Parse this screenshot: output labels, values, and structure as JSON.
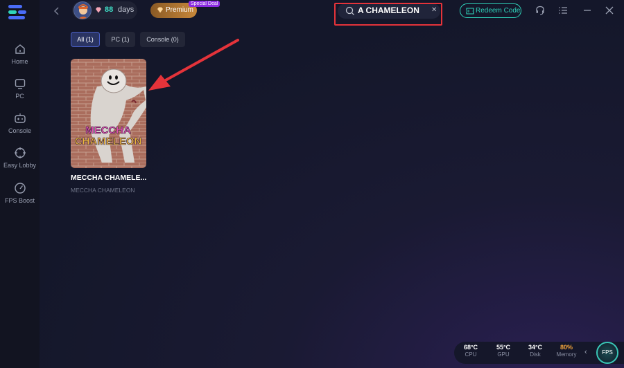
{
  "sidebar": {
    "items": [
      {
        "label": "Home",
        "icon": "home-icon"
      },
      {
        "label": "PC",
        "icon": "monitor-icon"
      },
      {
        "label": "Console",
        "icon": "gamepad-icon"
      },
      {
        "label": "Easy Lobby",
        "icon": "crosshair-icon"
      },
      {
        "label": "FPS Boost",
        "icon": "speedometer-icon"
      }
    ]
  },
  "header": {
    "days_value": "88",
    "days_unit": "days",
    "premium_label": "Premium",
    "special_deal": "Special Deal",
    "search_value": "A CHAMELEON",
    "redeem_label": "Redeem Code"
  },
  "tabs": [
    {
      "label": "All (1)",
      "active": true
    },
    {
      "label": "PC (1)",
      "active": false
    },
    {
      "label": "Console (0)",
      "active": false
    }
  ],
  "games": [
    {
      "title": "MECCHA CHAMELE...",
      "subtitle": "MECCHA CHAMELEON",
      "art_text_1": "MECCHA",
      "art_text_2": "CHAMELEON"
    }
  ],
  "stats": [
    {
      "value": "68°C",
      "label": "CPU",
      "color": "#ffffff"
    },
    {
      "value": "55°C",
      "label": "GPU",
      "color": "#ffffff"
    },
    {
      "value": "34°C",
      "label": "Disk",
      "color": "#ffffff"
    },
    {
      "value": "80%",
      "label": "Memory",
      "color": "#f3a43a"
    }
  ],
  "fps_label": "FPS",
  "colors": {
    "accent": "#2fd4bb",
    "highlight": "#e5333a",
    "premium": "#c8883a"
  }
}
